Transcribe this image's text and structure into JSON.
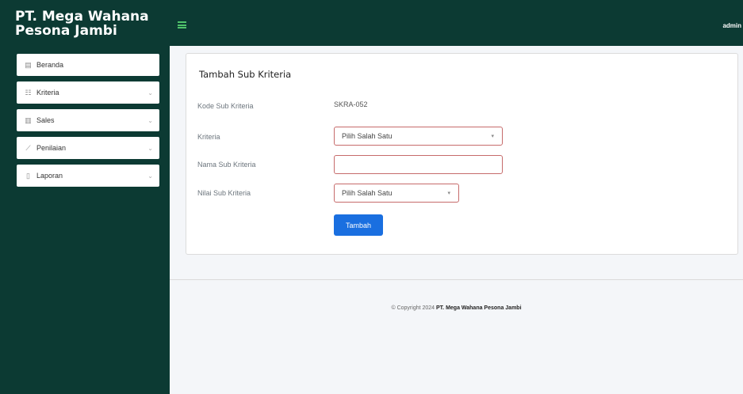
{
  "brand": {
    "line1": "PT. Mega Wahana",
    "line2": "Pesona Jambi"
  },
  "topbar": {
    "user": "admin"
  },
  "sidebar": {
    "items": [
      {
        "label": "Beranda",
        "icon": "home-icon",
        "has_children": false
      },
      {
        "label": "Kriteria",
        "icon": "list-icon",
        "has_children": true
      },
      {
        "label": "Sales",
        "icon": "table-icon",
        "has_children": true
      },
      {
        "label": "Penilaian",
        "icon": "chart-icon",
        "has_children": true
      },
      {
        "label": "Laporan",
        "icon": "document-icon",
        "has_children": true
      }
    ]
  },
  "form": {
    "title": "Tambah Sub Kriteria",
    "kode_label": "Kode Sub Kriteria",
    "kode_value": "SKRA-052",
    "kriteria_label": "Kriteria",
    "kriteria_selected": "Pilih Salah Satu",
    "nama_label": "Nama Sub Kriteria",
    "nama_value": "",
    "nilai_label": "Nilai Sub Kriteria",
    "nilai_selected": "Pilih Salah Satu",
    "submit_label": "Tambah"
  },
  "footer": {
    "prefix": "© Copyright 2024 ",
    "company": "PT. Mega Wahana Pesona Jambi"
  },
  "colors": {
    "sidebar_bg": "#0c3a33",
    "accent_green": "#4fc36b",
    "button_blue": "#1a6fe0",
    "invalid_border": "#c66b6b"
  }
}
